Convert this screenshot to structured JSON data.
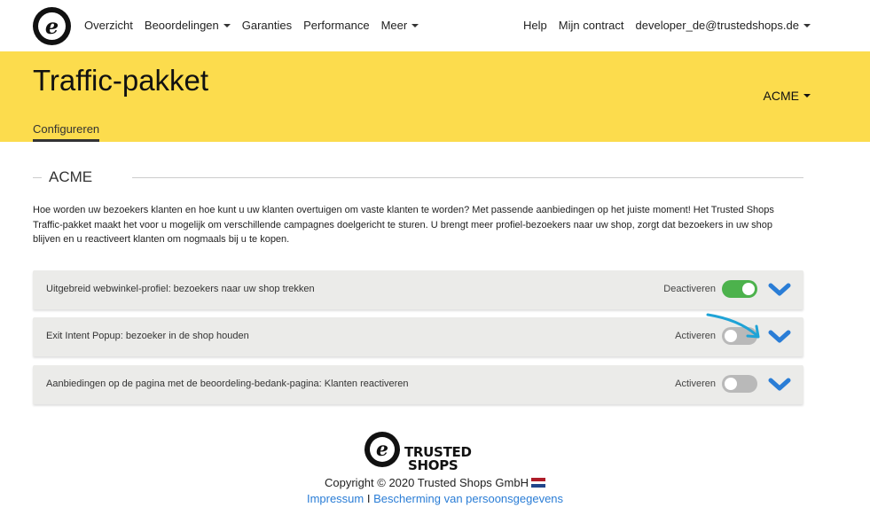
{
  "nav": {
    "logo_glyph": "e",
    "left_items": [
      {
        "label": "Overzicht",
        "dropdown": false
      },
      {
        "label": "Beoordelingen",
        "dropdown": true
      },
      {
        "label": "Garanties",
        "dropdown": false
      },
      {
        "label": "Performance",
        "dropdown": false
      },
      {
        "label": "Meer",
        "dropdown": true
      }
    ],
    "right_items": [
      {
        "label": "Help",
        "dropdown": false
      },
      {
        "label": "Mijn contract",
        "dropdown": false
      },
      {
        "label": "developer_de@trustedshops.de",
        "dropdown": true
      }
    ]
  },
  "header": {
    "title": "Traffic-pakket",
    "shop_selector": "ACME",
    "tab": "Configureren",
    "background_color": "#fcdc4d"
  },
  "section": {
    "heading": "ACME",
    "intro": "Hoe worden uw bezoekers klanten en hoe kunt u uw klanten overtuigen om vaste klanten te worden? Met passende aanbiedingen op het juiste moment! Het Trusted Shops Traffic-pakket maakt het voor u mogelijk om verschillende campagnes doelgericht te sturen. U brengt meer profiel-bezoekers naar uw shop, zorgt dat bezoekers in uw shop blijven en u reactiveert klanten om nogmaals bij u te kopen."
  },
  "features": [
    {
      "label": "Uitgebreid webwinkel-profiel: bezoekers naar uw shop trekken",
      "action": "Deactiveren",
      "enabled": true
    },
    {
      "label": "Exit Intent Popup: bezoeker in de shop houden",
      "action": "Activeren",
      "enabled": false
    },
    {
      "label": "Aanbiedingen op de pagina met de beoordeling-bedank-pagina: Klanten reactiveren",
      "action": "Activeren",
      "enabled": false
    }
  ],
  "colors": {
    "toggle_on": "#4cb24c",
    "toggle_off": "#b9b9b9",
    "chevron": "#2a7dd6",
    "annotation_arrow": "#1fa3d6"
  },
  "footer": {
    "logo_text_line1": "TRUSTED",
    "logo_text_line2": "SHOPS",
    "copyright": "Copyright © 2020 Trusted Shops GmbH",
    "flag_icon": "netherlands-flag-icon",
    "link_impressum": "Impressum",
    "separator": "I",
    "link_privacy": "Bescherming van persoonsgegevens"
  }
}
